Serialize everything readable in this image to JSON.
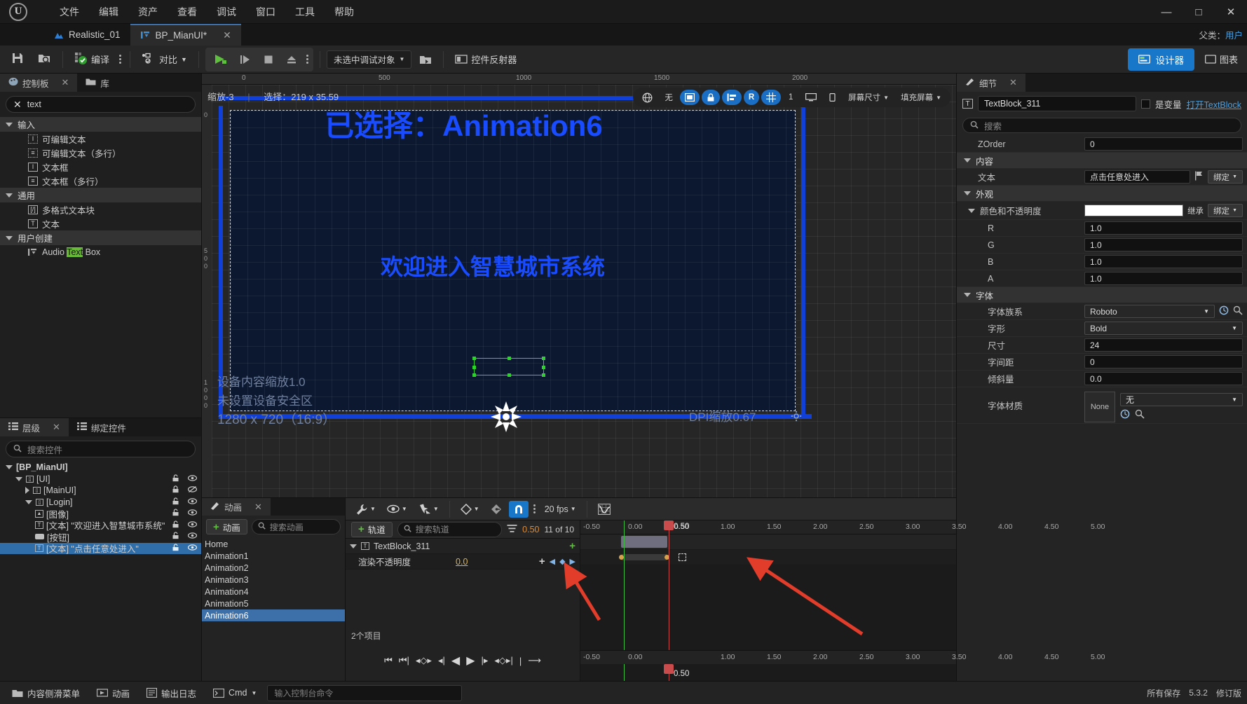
{
  "window": {
    "minimize": "—",
    "maximize": "□",
    "close": "✕",
    "parent_class_label": "父类：",
    "parent_class_value": "用户"
  },
  "menubar": [
    "文件",
    "编辑",
    "资产",
    "查看",
    "调试",
    "窗口",
    "工具",
    "帮助"
  ],
  "tabs": [
    {
      "label": "Realistic_01",
      "active": false,
      "closable": false
    },
    {
      "label": "BP_MianUI*",
      "active": true,
      "closable": true
    }
  ],
  "toolbar": {
    "save_icon": "save-icon",
    "browse_icon": "browse-to-asset-icon",
    "compile_label": "编译",
    "diff_label": "对比",
    "play_icon": "play-icon",
    "step_icon": "step-icon",
    "stop_icon": "stop-icon",
    "eject_icon": "eject-icon",
    "debug_object": "未选中调试对象",
    "widget_reflector": "控件反射器",
    "designer_label": "设计器",
    "graph_label": "图表"
  },
  "palette": {
    "tab_palette": "控制板",
    "tab_library": "库",
    "search_value": "text",
    "clear_icon": "clear-icon",
    "categories": [
      {
        "name": "输入",
        "items": [
          {
            "label": "可编辑文本",
            "icon": "editable-text-icon"
          },
          {
            "label": "可编辑文本（多行）",
            "icon": "editable-text-multiline-icon"
          },
          {
            "label": "文本框",
            "icon": "text-box-icon"
          },
          {
            "label": "文本框（多行）",
            "icon": "text-box-multiline-icon"
          }
        ]
      },
      {
        "name": "通用",
        "items": [
          {
            "label": "多格式文本块",
            "icon": "rich-text-block-icon"
          },
          {
            "label": "文本",
            "icon": "text-icon"
          }
        ]
      },
      {
        "name": "用户创建",
        "items": [
          {
            "label_pre": "Audio ",
            "label_hl": "Text",
            "label_post": " Box",
            "icon": "user-widget-icon"
          }
        ]
      }
    ]
  },
  "hierarchy": {
    "tab_hierarchy": "层级",
    "tab_bound_widgets": "绑定控件",
    "search_placeholder": "搜索控件",
    "rows": [
      {
        "label": "[BP_MianUI]",
        "depth": 0,
        "expander": "down",
        "icon": "",
        "bold": true,
        "lock": "",
        "eye": ""
      },
      {
        "label": "[UI]",
        "depth": 1,
        "expander": "down",
        "icon": "panel-icon",
        "lock": "unlocked",
        "eye": "visible"
      },
      {
        "label": "[MainUI]",
        "depth": 2,
        "expander": "right",
        "icon": "panel-icon",
        "lock": "locked",
        "eye": "hidden"
      },
      {
        "label": "[Login]",
        "depth": 2,
        "expander": "down",
        "icon": "panel-icon",
        "lock": "unlocked",
        "eye": "visible"
      },
      {
        "label": "[图像]",
        "depth": 3,
        "expander": "",
        "icon": "image-icon",
        "lock": "unlocked",
        "eye": "visible"
      },
      {
        "label": "[文本] \"欢迎进入智慧城市系统\"",
        "depth": 3,
        "expander": "",
        "icon": "text-icon",
        "lock": "unlocked",
        "eye": "visible"
      },
      {
        "label": "[按钮]",
        "depth": 3,
        "expander": "",
        "icon": "button-icon",
        "lock": "unlocked",
        "eye": "visible"
      },
      {
        "label": "[文本] \"点击任意处进入\"",
        "depth": 3,
        "expander": "",
        "icon": "text-icon",
        "lock": "unlocked",
        "eye": "visible",
        "selected": true
      }
    ]
  },
  "viewport": {
    "ruler_marks": [
      "0",
      "500",
      "1000",
      "1500",
      "2000"
    ],
    "vruler_marks": [
      "0",
      "5",
      "0",
      "0",
      "1",
      "0",
      "0",
      "0"
    ],
    "zoom_label": "缩放-3",
    "selection_label": "选择：219 x 35.59",
    "fill_none": "无",
    "screen_size_label": "屏幕尺寸",
    "fill_screen_label": "填充屏幕",
    "res_num": "1",
    "big_text": "已选择：Animation6",
    "mid_text": "欢迎进入智慧城市系统",
    "ghost_scale": "设备内容缩放1.0",
    "ghost_safe": "未设置设备安全区",
    "ghost_res": "1280 x 720（16:9）",
    "dpi_label": "DPI缩放0.67"
  },
  "details": {
    "tab_label": "细节",
    "widget_name": "TextBlock_311",
    "is_variable_label": "是变量",
    "open_textblock_link": "打开TextBlock",
    "search_placeholder": "搜索",
    "rows": [
      {
        "type": "prop",
        "name": "ZOrder",
        "value": "0",
        "indent": 1,
        "control": "field"
      },
      {
        "type": "section",
        "name": "内容"
      },
      {
        "type": "prop",
        "name": "文本",
        "value": "点击任意处进入",
        "indent": 1,
        "control": "field",
        "flag": true,
        "bind": "绑定"
      },
      {
        "type": "section",
        "name": "外观"
      },
      {
        "type": "subsection",
        "name": "颜色和不透明度",
        "control": "swatch",
        "swatch": "#ffffff",
        "inherit": "继承",
        "bind": "绑定"
      },
      {
        "type": "prop",
        "name": "R",
        "value": "1.0",
        "indent": 2,
        "control": "field"
      },
      {
        "type": "prop",
        "name": "G",
        "value": "1.0",
        "indent": 2,
        "control": "field"
      },
      {
        "type": "prop",
        "name": "B",
        "value": "1.0",
        "indent": 2,
        "control": "field"
      },
      {
        "type": "prop",
        "name": "A",
        "value": "1.0",
        "indent": 2,
        "control": "field"
      },
      {
        "type": "section",
        "name": "字体"
      },
      {
        "type": "prop",
        "name": "字体族系",
        "value": "Roboto",
        "indent": 2,
        "control": "select"
      },
      {
        "type": "prop",
        "name": "字形",
        "value": "Bold",
        "indent": 2,
        "control": "select"
      },
      {
        "type": "prop",
        "name": "尺寸",
        "value": "24",
        "indent": 2,
        "control": "field"
      },
      {
        "type": "prop",
        "name": "字间距",
        "value": "0",
        "indent": 2,
        "control": "field"
      },
      {
        "type": "prop",
        "name": "倾斜量",
        "value": "0.0",
        "indent": 2,
        "control": "field"
      },
      {
        "type": "material",
        "name": "字体材质",
        "thumb": "None",
        "value": "无"
      }
    ]
  },
  "animation": {
    "tab_label": "动画",
    "add_anim_label": "动画",
    "search_placeholder": "搜索动画",
    "items": [
      "Home",
      "Animation1",
      "Animation2",
      "Animation3",
      "Animation4",
      "Animation5",
      "Animation6"
    ],
    "selected": "Animation6"
  },
  "sequencer": {
    "toolbar_icons": [
      "wrench-icon",
      "eye-icon",
      "actions-icon",
      "key-icon",
      "keyframe-icon",
      "snap-magnet-icon"
    ],
    "fps_label": "20 fps",
    "curve_editor_icon": "curve-editor-icon",
    "add_track_label": "轨道",
    "track_search_placeholder": "搜索轨道",
    "filter_icon": "filter-icon",
    "current_time": "0.50",
    "frame_label": "11 of 10",
    "tracks": [
      {
        "name": "TextBlock_311",
        "icon": "text-icon",
        "depth": 0,
        "add": "+"
      },
      {
        "name": "渲染不透明度",
        "icon": "",
        "depth": 1,
        "value": "0.0"
      }
    ],
    "item_count": "2个项目",
    "ruler_marks": [
      "-0.50",
      "0.00",
      "0.50",
      "1.00",
      "1.50",
      "2.00",
      "2.50",
      "3.00",
      "3.50",
      "4.00",
      "4.50",
      "5.00"
    ],
    "playhead_label": "0.50",
    "transport_icons": [
      "jump-to-start-icon",
      "step-back-frames-icon",
      "prev-key-icon",
      "step-back-icon",
      "play-reverse-icon",
      "play-icon",
      "step-forward-icon",
      "next-key-icon",
      "step-forward-frames-icon",
      "jump-to-end-icon",
      "loop-icon"
    ]
  },
  "statusbar": {
    "content_drawer": "内容侧滑菜单",
    "animation": "动画",
    "output_log": "输出日志",
    "cmd_label": "Cmd",
    "cmd_placeholder": "输入控制台命令",
    "right_text": "所有保存",
    "version": "5.3.2",
    "revision": "修订版"
  },
  "colors": {
    "accent_blue": "#1877c9",
    "select_blue": "#3d6fa8",
    "green": "#5fbf3f",
    "canvas_blue": "#0c1830",
    "text_blue": "#1a4cff",
    "annot_red": "#e23c2b"
  }
}
